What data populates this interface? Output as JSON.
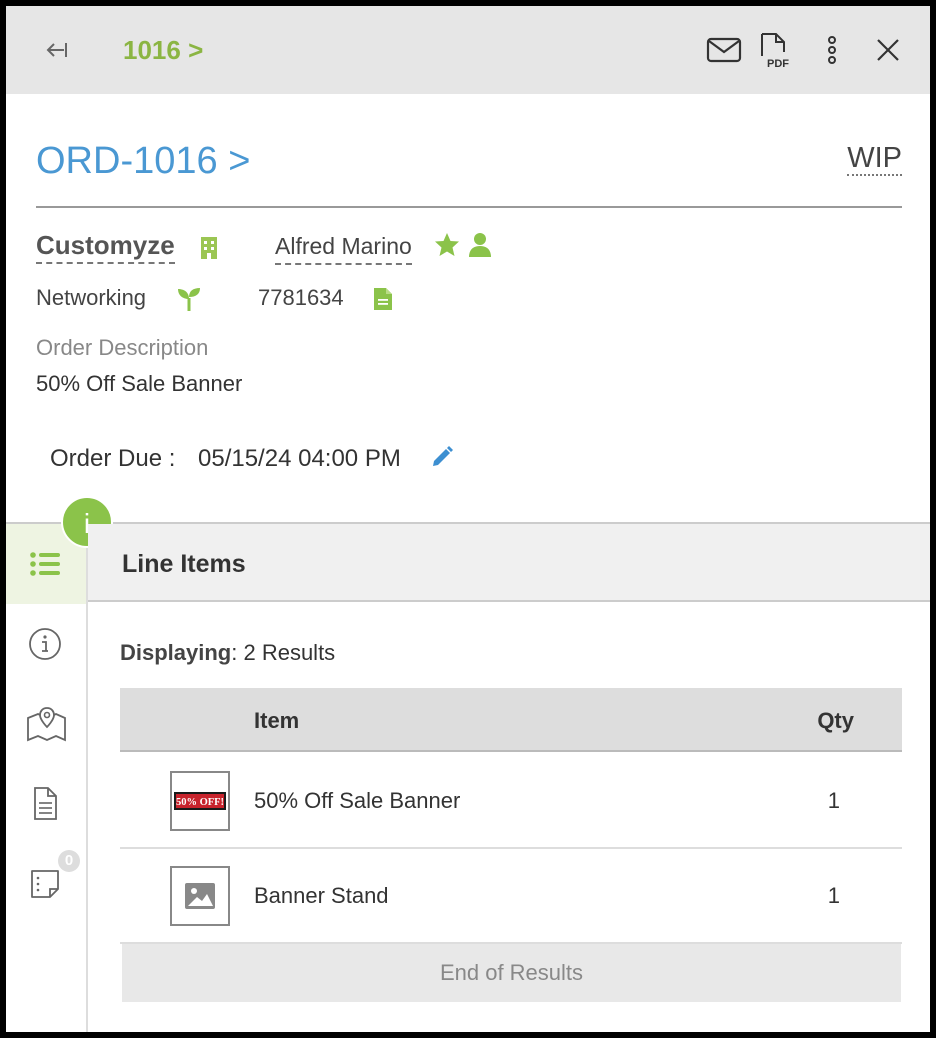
{
  "topbar": {
    "breadcrumb": "1016 >",
    "icons": [
      "back-arrow-icon",
      "email-icon",
      "pdf-icon",
      "more-vertical-icon",
      "close-icon"
    ],
    "pdf_label": "PDF"
  },
  "order": {
    "title": "ORD-1016 >",
    "status": "WIP",
    "customer": "Customyze",
    "contact": "Alfred Marino",
    "industry": "Networking",
    "account_number": "7781634",
    "description_label": "Order Description",
    "description": "50% Off Sale Banner",
    "due_label": "Order Due :",
    "due_value": "05/15/24 04:00 PM"
  },
  "sidebar": {
    "items": [
      "line-items-icon",
      "info-icon",
      "map-icon",
      "document-icon",
      "notes-icon"
    ],
    "info_badge": "i",
    "notes_count": "0"
  },
  "line_items": {
    "section_title": "Line Items",
    "displaying_label": "Displaying",
    "displaying_value": ": 2 Results",
    "columns": {
      "item": "Item",
      "qty": "Qty"
    },
    "rows": [
      {
        "name": "50% Off Sale Banner",
        "qty": "1",
        "thumb_text": "50% OFF!"
      },
      {
        "name": "Banner Stand",
        "qty": "1"
      }
    ],
    "end_label": "End of Results"
  },
  "colors": {
    "accent_green": "#8bb543",
    "link_blue": "#4a98d3",
    "header_gray": "#e6e6e6"
  }
}
